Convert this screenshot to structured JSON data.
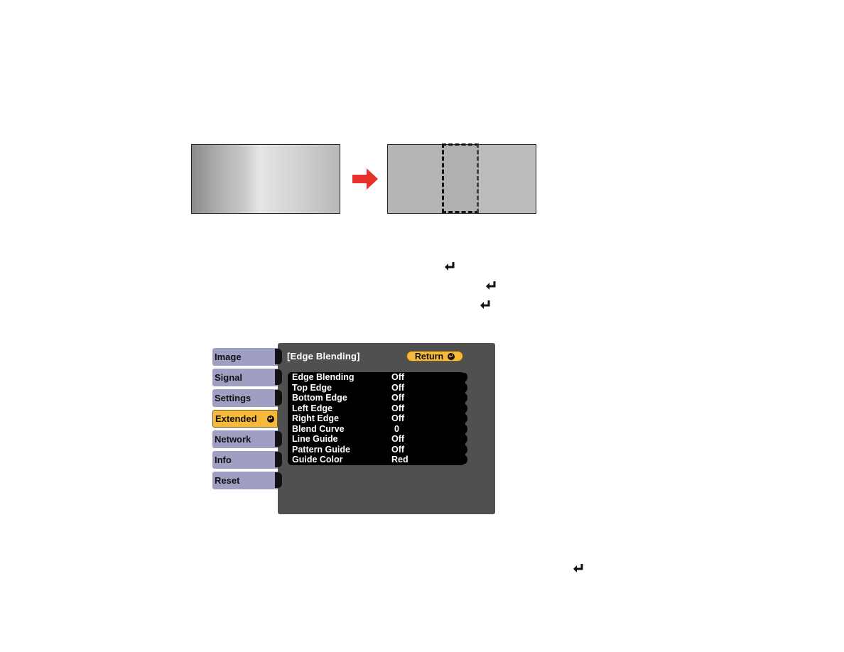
{
  "illustration": {
    "before_label": "uneven-brightness-overlap",
    "after_label": "blended-overlap-area",
    "arrow_color": "#e8302a"
  },
  "enter_icons": [
    "enter-icon",
    "enter-icon",
    "enter-icon",
    "enter-icon"
  ],
  "menu": {
    "title": "[Edge Blending]",
    "return_label": "Return",
    "return_icon": "↵",
    "tabs": [
      {
        "label": "Image",
        "active": false
      },
      {
        "label": "Signal",
        "active": false
      },
      {
        "label": "Settings",
        "active": false
      },
      {
        "label": "Extended",
        "active": true,
        "icon": "↵"
      },
      {
        "label": "Network",
        "active": false
      },
      {
        "label": "Info",
        "active": false
      },
      {
        "label": "Reset",
        "active": false
      }
    ],
    "rows": [
      {
        "label": "Edge Blending",
        "value": "Off"
      },
      {
        "label": "Top Edge",
        "value": "Off"
      },
      {
        "label": "Bottom Edge",
        "value": "Off"
      },
      {
        "label": "Left Edge",
        "value": "Off"
      },
      {
        "label": "Right Edge",
        "value": "Off"
      },
      {
        "label": "Blend Curve",
        "value": "0"
      },
      {
        "label": "Line Guide",
        "value": "Off"
      },
      {
        "label": "Pattern Guide",
        "value": "Off"
      },
      {
        "label": "Guide Color",
        "value": "Red"
      }
    ],
    "colors": {
      "accent": "#f6b93b",
      "tab": "#9f9fc4",
      "panel": "#505050"
    }
  }
}
